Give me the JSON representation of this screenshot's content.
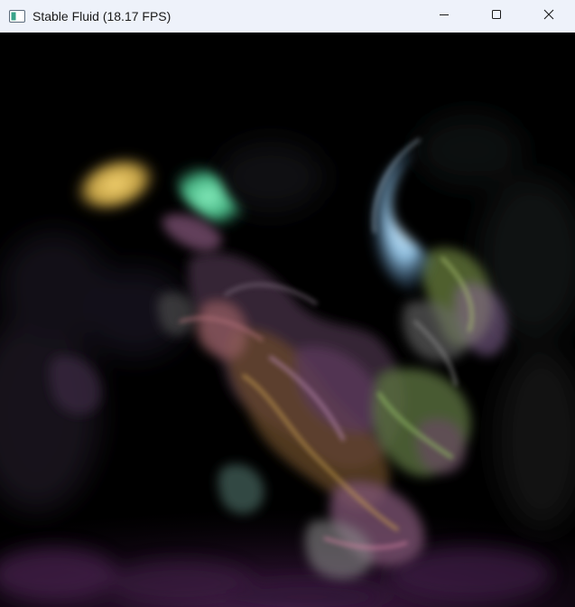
{
  "window": {
    "title": "Stable Fluid (18.17 FPS)",
    "app_icon": "window-app-icon",
    "controls": [
      {
        "name": "minimize-button",
        "icon": "minimize-icon"
      },
      {
        "name": "maximize-button",
        "icon": "maximize-icon"
      },
      {
        "name": "close-button",
        "icon": "close-icon"
      }
    ]
  },
  "simulation": {
    "background_color": "#000000",
    "dye_colors": {
      "yellow": "#e6c25a",
      "mint": "#5fd6a0",
      "light_blue": "#a8dcff",
      "olive_green": "#8fa85a",
      "mauve": "#9a6a8e",
      "rose": "#b8707a",
      "purple": "#5a2c5e",
      "teal_grey": "#5e7a78"
    }
  }
}
